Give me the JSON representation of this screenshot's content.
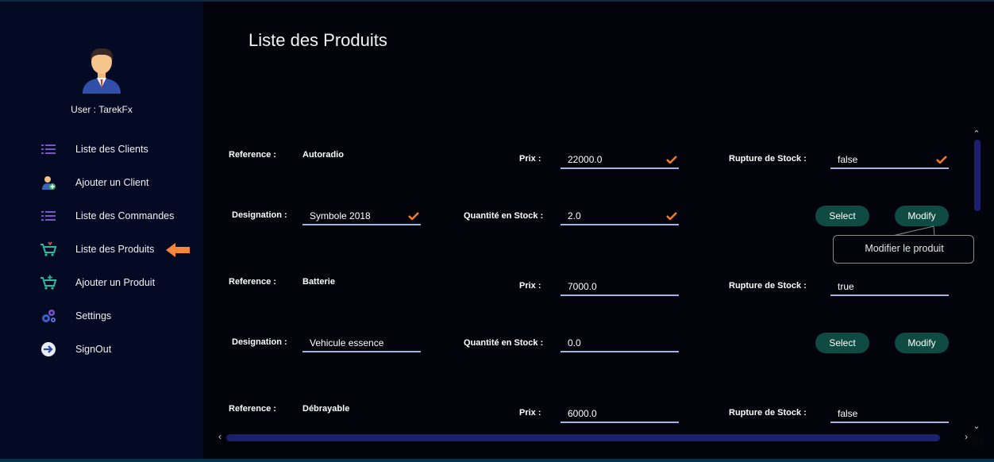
{
  "sidebar": {
    "user_label": "User : TarekFx",
    "items": [
      {
        "label": "Liste des Clients",
        "icon": "list-icon"
      },
      {
        "label": "Ajouter un Client",
        "icon": "add-user-icon"
      },
      {
        "label": "Liste des Commandes",
        "icon": "list-icon"
      },
      {
        "label": "Liste des Produits",
        "icon": "cart-icon",
        "active": true
      },
      {
        "label": "Ajouter un Produit",
        "icon": "cart-add-icon"
      },
      {
        "label": "Settings",
        "icon": "gears-icon"
      },
      {
        "label": "SignOut",
        "icon": "signout-icon"
      }
    ]
  },
  "main": {
    "title": "Liste des Produits",
    "labels": {
      "reference": "Reference :",
      "designation": "Designation :",
      "prix": "Prix :",
      "quantite": "Quantité en Stock :",
      "rupture": "Rupture de Stock :"
    },
    "buttons": {
      "select": "Select",
      "modify": "Modify"
    },
    "tooltip": "Modifier le produit",
    "products": [
      {
        "reference": "Autoradio",
        "designation": "Symbole 2018",
        "prix": "22000.0",
        "quantite": "2.0",
        "rupture": "false"
      },
      {
        "reference": "Batterie",
        "designation": "Vehicule essence",
        "prix": "7000.0",
        "quantite": "0.0",
        "rupture": "true"
      },
      {
        "reference": "Débrayable",
        "prix": "6000.0",
        "rupture": "false"
      }
    ]
  },
  "colors": {
    "sidebar_bg": "#050a24",
    "main_bg": "#03030c",
    "button_bg": "#0f4a43",
    "check_color": "#f07a2a",
    "arrow_color": "#f5863a",
    "scroll_color": "#1d1f6f"
  }
}
